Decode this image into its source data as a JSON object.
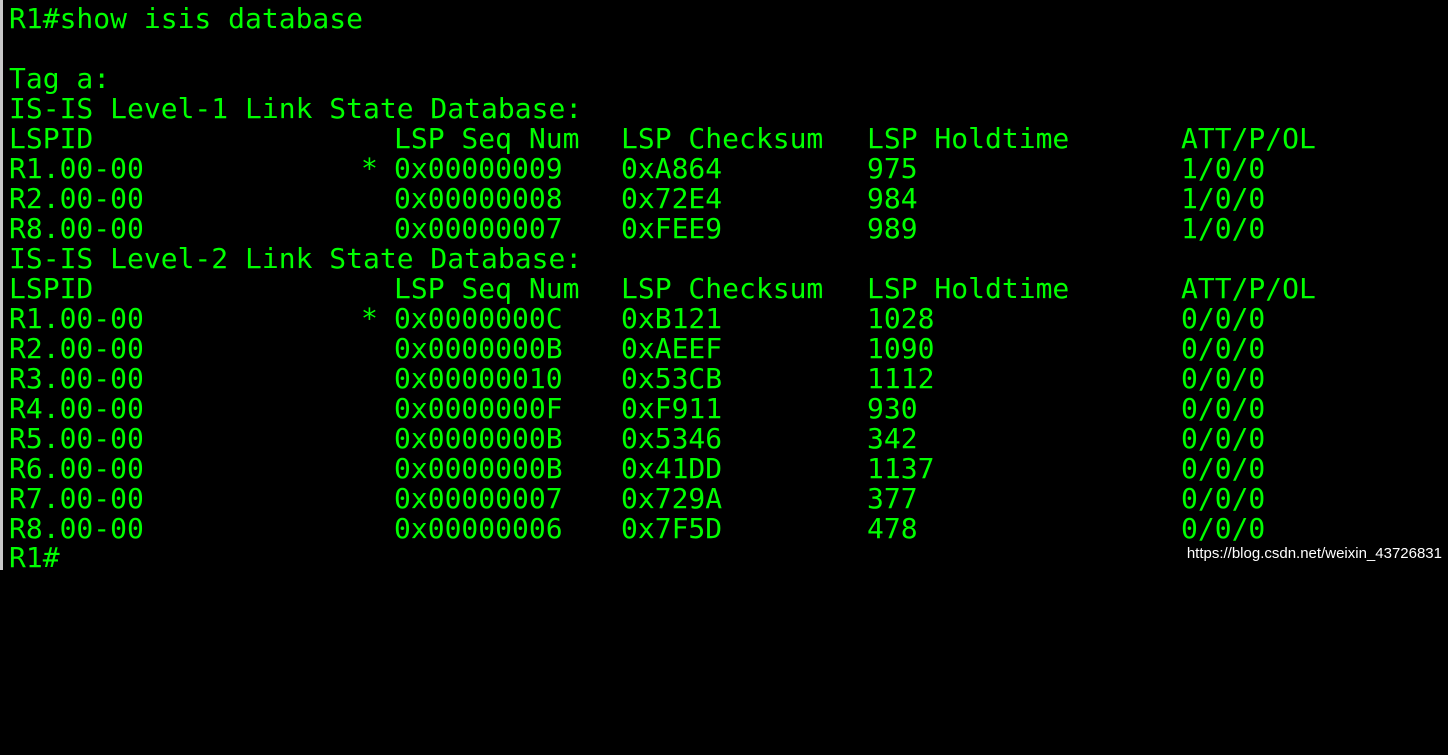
{
  "command": "R1#show isis database",
  "tag": "Tag a:",
  "level1": {
    "title": "IS-IS Level-1 Link State Database:",
    "headers": [
      "LSPID",
      "LSP Seq Num",
      "LSP Checksum",
      "LSP Holdtime",
      "ATT/P/OL"
    ],
    "rows": [
      {
        "lspid": "R1.00-00",
        "star": "*",
        "seq": "0x00000009",
        "checksum": "0xA864",
        "holdtime": "975",
        "flags": "1/0/0"
      },
      {
        "lspid": "R2.00-00",
        "star": "",
        "seq": "0x00000008",
        "checksum": "0x72E4",
        "holdtime": "984",
        "flags": "1/0/0"
      },
      {
        "lspid": "R8.00-00",
        "star": "",
        "seq": "0x00000007",
        "checksum": "0xFEE9",
        "holdtime": "989",
        "flags": "1/0/0"
      }
    ]
  },
  "level2": {
    "title": "IS-IS Level-2 Link State Database:",
    "headers": [
      "LSPID",
      "LSP Seq Num",
      "LSP Checksum",
      "LSP Holdtime",
      "ATT/P/OL"
    ],
    "rows": [
      {
        "lspid": "R1.00-00",
        "star": "*",
        "seq": "0x0000000C",
        "checksum": "0xB121",
        "holdtime": "1028",
        "flags": "0/0/0"
      },
      {
        "lspid": "R2.00-00",
        "star": "",
        "seq": "0x0000000B",
        "checksum": "0xAEEF",
        "holdtime": "1090",
        "flags": "0/0/0"
      },
      {
        "lspid": "R3.00-00",
        "star": "",
        "seq": "0x00000010",
        "checksum": "0x53CB",
        "holdtime": "1112",
        "flags": "0/0/0"
      },
      {
        "lspid": "R4.00-00",
        "star": "",
        "seq": "0x0000000F",
        "checksum": "0xF911",
        "holdtime": "930",
        "flags": "0/0/0"
      },
      {
        "lspid": "R5.00-00",
        "star": "",
        "seq": "0x0000000B",
        "checksum": "0x5346",
        "holdtime": "342",
        "flags": "0/0/0"
      },
      {
        "lspid": "R6.00-00",
        "star": "",
        "seq": "0x0000000B",
        "checksum": "0x41DD",
        "holdtime": "1137",
        "flags": "0/0/0"
      },
      {
        "lspid": "R7.00-00",
        "star": "",
        "seq": "0x00000007",
        "checksum": "0x729A",
        "holdtime": "377",
        "flags": "0/0/0"
      },
      {
        "lspid": "R8.00-00",
        "star": "",
        "seq": "0x00000006",
        "checksum": "0x7F5D",
        "holdtime": "478",
        "flags": "0/0/0"
      }
    ]
  },
  "prompt": "R1#",
  "watermark": "https://blog.csdn.net/weixin_43726831",
  "colors": {
    "text": "#00ff00",
    "background": "#000000"
  }
}
